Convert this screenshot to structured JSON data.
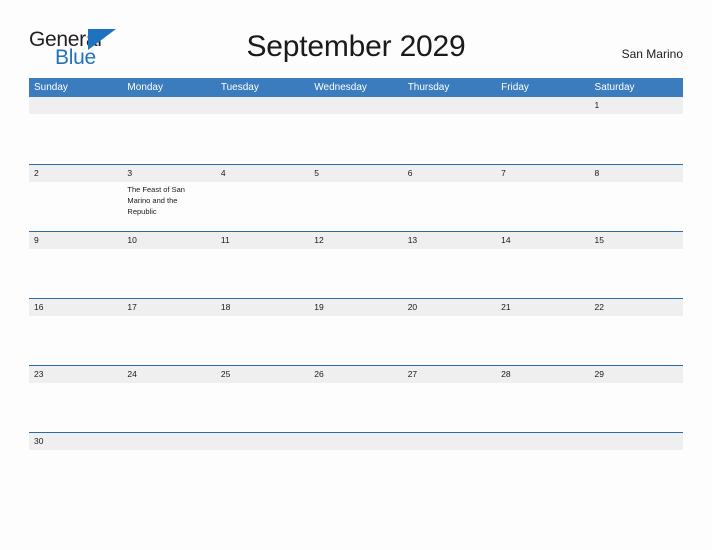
{
  "brand": {
    "name_part1": "General",
    "name_part2": "Blue",
    "flag_icon": "triangle-flag-icon",
    "accent_color": "#1f72bd"
  },
  "header": {
    "title": "September 2029",
    "region": "San Marino"
  },
  "colors": {
    "weekday_header_bg": "#3a7cbe",
    "weekday_header_text": "#ffffff",
    "row_divider": "#2b6ca8",
    "date_band_bg": "#efefef",
    "cell_bg": "#fdfdfd",
    "text": "#1a1a1a"
  },
  "calendar": {
    "month": "September",
    "year": "2029",
    "weekday_headers": [
      "Sunday",
      "Monday",
      "Tuesday",
      "Wednesday",
      "Thursday",
      "Friday",
      "Saturday"
    ],
    "weeks": [
      {
        "days": [
          {
            "num": "",
            "events": []
          },
          {
            "num": "",
            "events": []
          },
          {
            "num": "",
            "events": []
          },
          {
            "num": "",
            "events": []
          },
          {
            "num": "",
            "events": []
          },
          {
            "num": "",
            "events": []
          },
          {
            "num": "1",
            "events": []
          }
        ]
      },
      {
        "days": [
          {
            "num": "2",
            "events": []
          },
          {
            "num": "3",
            "events": [
              "The Feast of San Marino and the Republic"
            ]
          },
          {
            "num": "4",
            "events": []
          },
          {
            "num": "5",
            "events": []
          },
          {
            "num": "6",
            "events": []
          },
          {
            "num": "7",
            "events": []
          },
          {
            "num": "8",
            "events": []
          }
        ]
      },
      {
        "days": [
          {
            "num": "9",
            "events": []
          },
          {
            "num": "10",
            "events": []
          },
          {
            "num": "11",
            "events": []
          },
          {
            "num": "12",
            "events": []
          },
          {
            "num": "13",
            "events": []
          },
          {
            "num": "14",
            "events": []
          },
          {
            "num": "15",
            "events": []
          }
        ]
      },
      {
        "days": [
          {
            "num": "16",
            "events": []
          },
          {
            "num": "17",
            "events": []
          },
          {
            "num": "18",
            "events": []
          },
          {
            "num": "19",
            "events": []
          },
          {
            "num": "20",
            "events": []
          },
          {
            "num": "21",
            "events": []
          },
          {
            "num": "22",
            "events": []
          }
        ]
      },
      {
        "days": [
          {
            "num": "23",
            "events": []
          },
          {
            "num": "24",
            "events": []
          },
          {
            "num": "25",
            "events": []
          },
          {
            "num": "26",
            "events": []
          },
          {
            "num": "27",
            "events": []
          },
          {
            "num": "28",
            "events": []
          },
          {
            "num": "29",
            "events": []
          }
        ]
      },
      {
        "days": [
          {
            "num": "30",
            "events": []
          },
          {
            "num": "",
            "events": []
          },
          {
            "num": "",
            "events": []
          },
          {
            "num": "",
            "events": []
          },
          {
            "num": "",
            "events": []
          },
          {
            "num": "",
            "events": []
          },
          {
            "num": "",
            "events": []
          }
        ]
      }
    ]
  }
}
